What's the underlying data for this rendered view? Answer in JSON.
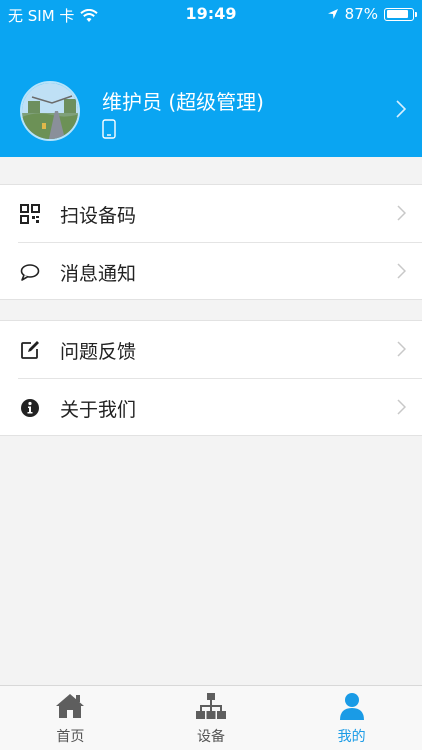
{
  "status_bar": {
    "carrier": "无 SIM 卡",
    "time": "19:49",
    "battery": "87%",
    "battery_level": 0.87
  },
  "profile": {
    "name": "维护员 (超级管理)"
  },
  "menu": {
    "group1": [
      {
        "label": "扫设备码",
        "icon": "qrcode-icon"
      },
      {
        "label": "消息通知",
        "icon": "chat-bubble-icon"
      }
    ],
    "group2": [
      {
        "label": "问题反馈",
        "icon": "edit-icon"
      },
      {
        "label": "关于我们",
        "icon": "info-icon"
      }
    ]
  },
  "tabbar": {
    "items": [
      {
        "label": "首页",
        "icon": "home-icon",
        "active": false
      },
      {
        "label": "设备",
        "icon": "network-icon",
        "active": false
      },
      {
        "label": "我的",
        "icon": "user-icon",
        "active": true
      }
    ]
  },
  "colors": {
    "header": "#0aa5f2",
    "active_tab": "#1a9be6",
    "background": "#f3f3f3"
  }
}
